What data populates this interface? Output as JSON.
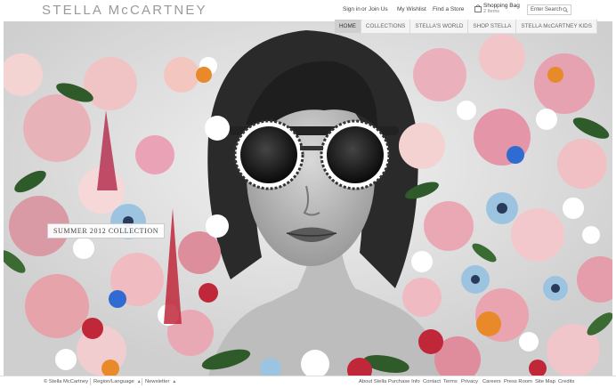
{
  "header": {
    "logo": "STELLA McCARTNEY",
    "sign_in": "Sign in",
    "or": "or",
    "join_us": "Join Us",
    "wishlist": "My Wishlist",
    "find_store": "Find a Store",
    "bag_label": "Shopping Bag",
    "bag_count": "2 Items",
    "search_placeholder": "Enter Search"
  },
  "nav": {
    "items": [
      {
        "label": "HOME",
        "active": true
      },
      {
        "label": "COLLECTIONS"
      },
      {
        "label": "STELLA'S WORLD"
      },
      {
        "label": "SHOP STELLA"
      },
      {
        "label": "STELLA McCARTNEY KIDS"
      }
    ]
  },
  "hero": {
    "collection_label": "SUMMER 2012 COLLECTION"
  },
  "footer": {
    "copyright": "© Stella McCartney",
    "region": "Region/Language",
    "newsletter": "Newsletter",
    "links": [
      "About Stella",
      "Purchase Info",
      "Contact",
      "Terms",
      "Privacy",
      "Careers",
      "Press Room",
      "Site Map",
      "Credits"
    ]
  },
  "colors": {
    "logo": "#9a9a9a",
    "nav_active": "#cfcfcf",
    "flower_pink": "#e8a0b0",
    "flower_blue": "#9cc4e0",
    "flower_red": "#c0283a",
    "leaf_green": "#2f5a2a"
  }
}
